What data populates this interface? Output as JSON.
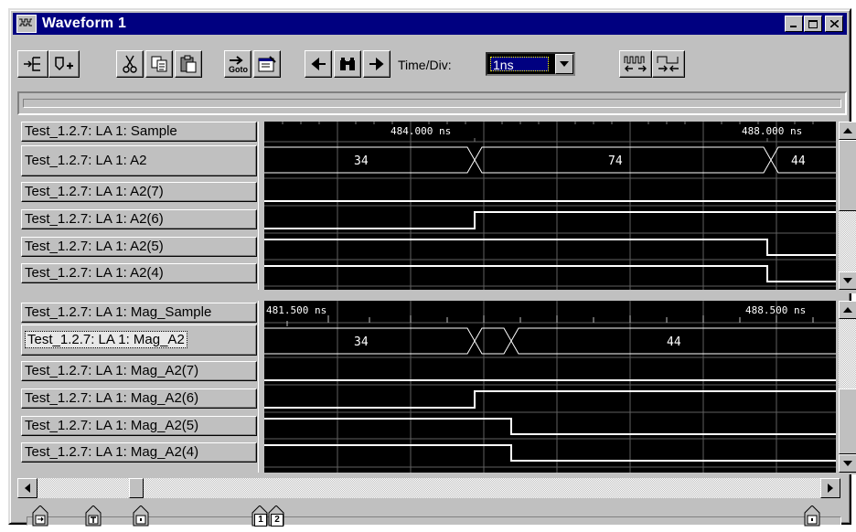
{
  "window": {
    "title": "Waveform 1",
    "buttons": [
      "_",
      "□",
      "X"
    ]
  },
  "toolbar": {
    "time_div_label": "Time/Div:",
    "time_div_value": "1ns",
    "goto_label": "Goto",
    "icons": [
      "add-signal-icon",
      "add-bus-icon",
      "cut-icon",
      "copy-icon",
      "paste-icon",
      "goto-icon",
      "properties-icon",
      "prev-icon",
      "find-icon",
      "next-icon",
      "zoom-out-icon",
      "zoom-in-icon"
    ]
  },
  "top_pane": {
    "signals": [
      {
        "label": "Test_1.2.7: LA 1: Sample"
      },
      {
        "label": "Test_1.2.7: LA 1: A2"
      },
      {
        "label": "Test_1.2.7: LA 1: A2(7)"
      },
      {
        "label": "Test_1.2.7: LA 1: A2(6)"
      },
      {
        "label": "Test_1.2.7: LA 1: A2(5)"
      },
      {
        "label": "Test_1.2.7: LA 1: A2(4)"
      }
    ],
    "time_labels": [
      "484.000 ns",
      "488.000 ns"
    ],
    "bus_values": [
      "34",
      "74",
      "44"
    ]
  },
  "bottom_pane": {
    "signals": [
      {
        "label": "Test_1.2.7: LA 1: Mag_Sample"
      },
      {
        "label": "Test_1.2.7: LA 1: Mag_A2"
      },
      {
        "label": "Test_1.2.7: LA 1: Mag_A2(7)"
      },
      {
        "label": "Test_1.2.7: LA 1: Mag_A2(6)"
      },
      {
        "label": "Test_1.2.7: LA 1: Mag_A2(5)"
      },
      {
        "label": "Test_1.2.7: LA 1: Mag_A2(4)"
      }
    ],
    "time_labels": [
      "481.500 ns",
      "488.500 ns"
    ],
    "bus_values": [
      "34",
      "44"
    ]
  },
  "markers": {
    "numbered": [
      "1",
      "2"
    ]
  }
}
